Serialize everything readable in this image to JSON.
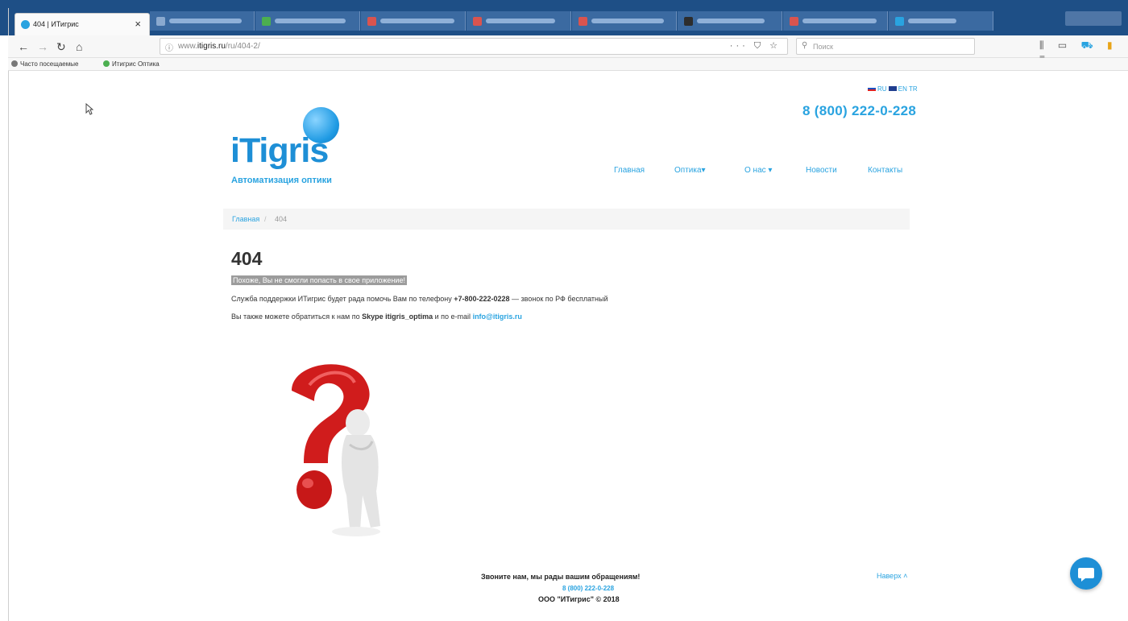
{
  "browser": {
    "active_tab": {
      "title": "404 | ИТигрис",
      "close": "×"
    },
    "nav": {
      "back": "←",
      "forward": "→",
      "reload": "↻",
      "home": "⌂"
    },
    "url": {
      "prefix": "www.",
      "domain": "itigris.ru",
      "path": "/ru/404-2/"
    },
    "url_actions": "··· ⛉ ☆",
    "search_placeholder": "Поиск",
    "toolbar_icons": [
      "library-icon",
      "sidebar-icon",
      "cart-icon",
      "flag-icon",
      "menu-icon"
    ],
    "bookmarks": [
      "Часто посещаемые",
      "Итигрис Оптика"
    ]
  },
  "header": {
    "languages": [
      "RU",
      "EN",
      "TR"
    ],
    "phone": "8 (800) 222-0-228",
    "logo_text": "iTigris",
    "logo_subtitle": "Автоматизация оптики",
    "nav": [
      "Главная",
      "Оптика▾",
      "О нас ▾",
      "Новости",
      "Контакты"
    ]
  },
  "breadcrumb": {
    "home": "Главная",
    "separator": "/",
    "current": "404"
  },
  "error": {
    "title": "404",
    "highlight": "Похоже, Вы не смогли попасть в свое приложение!",
    "line1_before": "Служба поддержки ИТигрис будет рада помочь Вам по телефону ",
    "line1_phone": "+7-800-222-0228",
    "line1_after": " — звонок по РФ бесплатный",
    "line2_before": "Вы также можете обратиться к нам по ",
    "line2_skype": "Skype itigris_optima",
    "line2_mid": " и по e-mail ",
    "line2_email": "info@itigris.ru"
  },
  "footer": {
    "message": "Звоните нам, мы рады вашим обращениям!",
    "phone": "8 (800) 222-0-228",
    "copyright": "ООО \"ИТигрис\" © 2018",
    "to_top": "Наверх ˄"
  },
  "colors": {
    "accent": "#29a3e0",
    "tabbar": "#1e4f86",
    "question_mark": "#d01c1c"
  }
}
